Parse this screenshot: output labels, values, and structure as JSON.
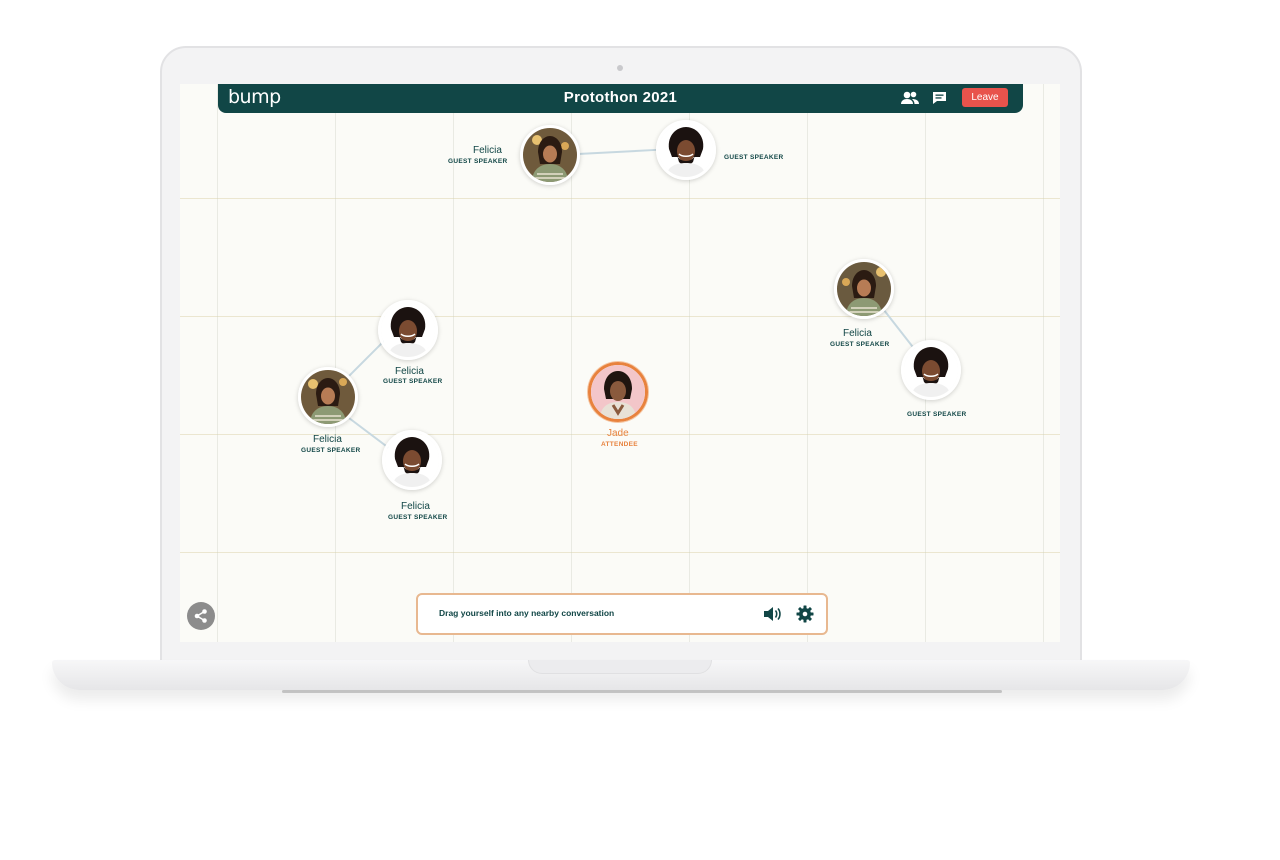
{
  "header": {
    "logo": "bump",
    "title": "Protothon 2021",
    "leave_label": "Leave",
    "icons": [
      "people-icon",
      "chat-icon"
    ]
  },
  "people": {
    "p1": {
      "name": "Felicia",
      "role": "GUEST SPEAKER"
    },
    "p2": {
      "name": "",
      "role": "GUEST SPEAKER"
    },
    "p3": {
      "name": "Felicia",
      "role": "GUEST SPEAKER"
    },
    "p4": {
      "name": "",
      "role": "GUEST SPEAKER"
    },
    "p5": {
      "name": "Felicia",
      "role": "GUEST SPEAKER"
    },
    "p6": {
      "name": "Felicia",
      "role": "GUEST SPEAKER"
    },
    "p7": {
      "name": "Felicia",
      "role": "GUEST SPEAKER"
    },
    "me": {
      "name": "Jade",
      "role": "ATTENDEE"
    }
  },
  "bottom_bar": {
    "hint": "Drag yourself into any nearby conversation",
    "icons": [
      "speaker-icon",
      "gear-icon"
    ]
  },
  "colors": {
    "header_bg": "#114646",
    "leave_bg": "#e8534c",
    "attendee_accent": "#e8823d"
  }
}
